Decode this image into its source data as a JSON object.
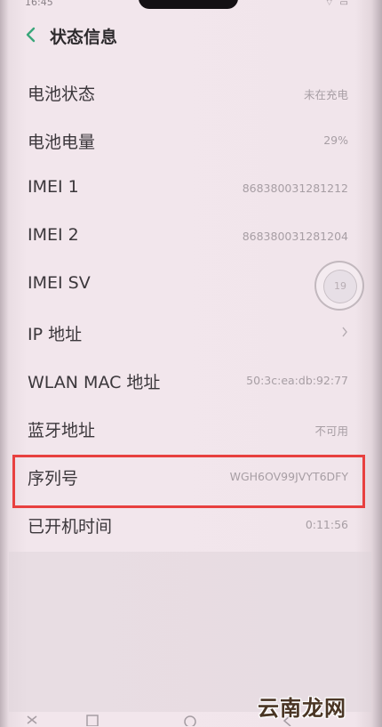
{
  "status_bar": {
    "time": "16:45",
    "icons": [
      "wifi-icon",
      "battery-icon"
    ]
  },
  "header": {
    "back_icon": "chevron-left-icon",
    "title": "状态信息"
  },
  "rows": [
    {
      "label": "电池状态",
      "value": "未在充电"
    },
    {
      "label": "电池电量",
      "value": "29%"
    },
    {
      "label": "IMEI 1",
      "value": "868380031281212"
    },
    {
      "label": "IMEI 2",
      "value": "868380031281204"
    },
    {
      "label": "IMEI SV",
      "value": ""
    },
    {
      "label": "IP 地址",
      "value": "",
      "chevron": true
    },
    {
      "label": "WLAN MAC 地址",
      "value": "50:3c:ea:db:92:77"
    },
    {
      "label": "蓝牙地址",
      "value": "不可用"
    },
    {
      "label": "序列号",
      "value": "WGH6OV99JVYT6DFY"
    },
    {
      "label": "已开机时间",
      "value": "0:11:56"
    }
  ],
  "assistive_ball": {
    "label": "19"
  },
  "nav_bar": {
    "icons": [
      "back-icon",
      "home-icon",
      "recent-apps-icon",
      "menu-icon"
    ]
  },
  "watermark": {
    "text": "云南龙网"
  },
  "colors": {
    "accent": "#3aa67a",
    "highlight": "#e8403f"
  }
}
